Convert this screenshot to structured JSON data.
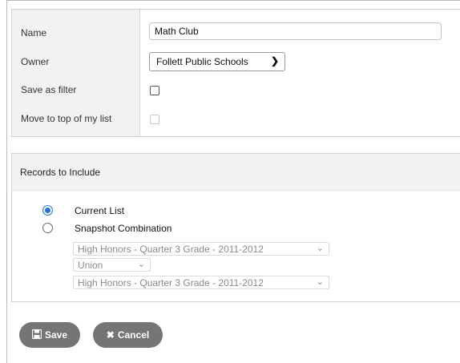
{
  "form": {
    "fields": {
      "name_label": "Name",
      "name_value": "Math Club",
      "owner_label": "Owner",
      "owner_value": "Follett Public Schools",
      "save_filter_label": "Save as filter",
      "move_top_label": "Move to top of my list"
    },
    "records": {
      "header": "Records to Include",
      "current_list_label": "Current List",
      "snapshot_label": "Snapshot Combination",
      "snapshot_first": "High Honors - Quarter 3 Grade - 2011-2012",
      "operation": "Union",
      "snapshot_second": "High Honors - Quarter 3 Grade - 2011-2012"
    },
    "buttons": {
      "save": "Save",
      "cancel": "Cancel"
    }
  },
  "icons": {
    "save": "floppy-disk-icon",
    "cancel": "x-icon",
    "chevron": "chevron-down-icon"
  },
  "colors": {
    "accent": "#1a73e8",
    "button_bg": "#757575",
    "label_column_bg": "#f2f2f2"
  }
}
